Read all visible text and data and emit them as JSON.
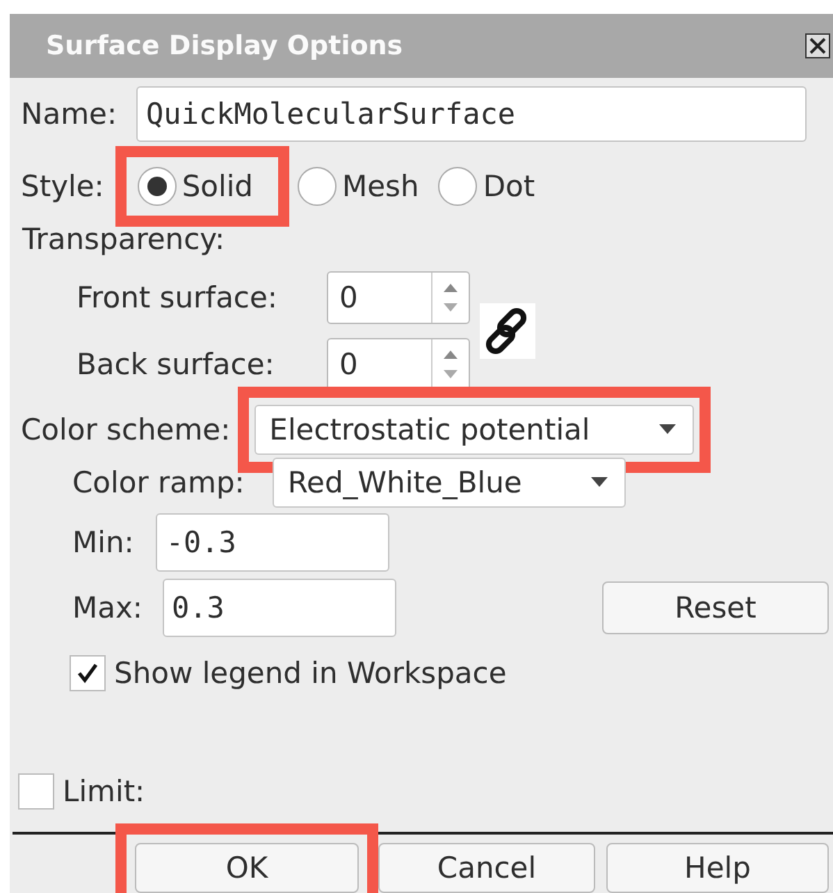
{
  "window": {
    "title": "Surface Display Options"
  },
  "name": {
    "label": "Name:",
    "value": "QuickMolecularSurface"
  },
  "style": {
    "label": "Style:",
    "options": [
      {
        "label": "Solid",
        "selected": true,
        "highlighted": true
      },
      {
        "label": "Mesh",
        "selected": false,
        "highlighted": false
      },
      {
        "label": "Dot",
        "selected": false,
        "highlighted": false
      }
    ]
  },
  "transparency": {
    "label": "Transparency:",
    "front": {
      "label": "Front surface:",
      "value": "0"
    },
    "back": {
      "label": "Back surface:",
      "value": "0"
    }
  },
  "color_scheme": {
    "label": "Color scheme:",
    "value": "Electrostatic potential",
    "highlighted": true
  },
  "color_ramp": {
    "label": "Color ramp:",
    "value": "Red_White_Blue"
  },
  "min": {
    "label": "Min:",
    "value": "-0.3"
  },
  "max": {
    "label": "Max:",
    "value": "0.3"
  },
  "reset": "Reset",
  "show_legend": {
    "label": "Show legend in Workspace",
    "checked": true
  },
  "limit": {
    "label": "Limit:",
    "checked": false
  },
  "buttons": [
    {
      "label": "OK",
      "highlighted": true
    },
    {
      "label": "Cancel",
      "highlighted": false
    },
    {
      "label": "Help",
      "highlighted": false
    }
  ]
}
